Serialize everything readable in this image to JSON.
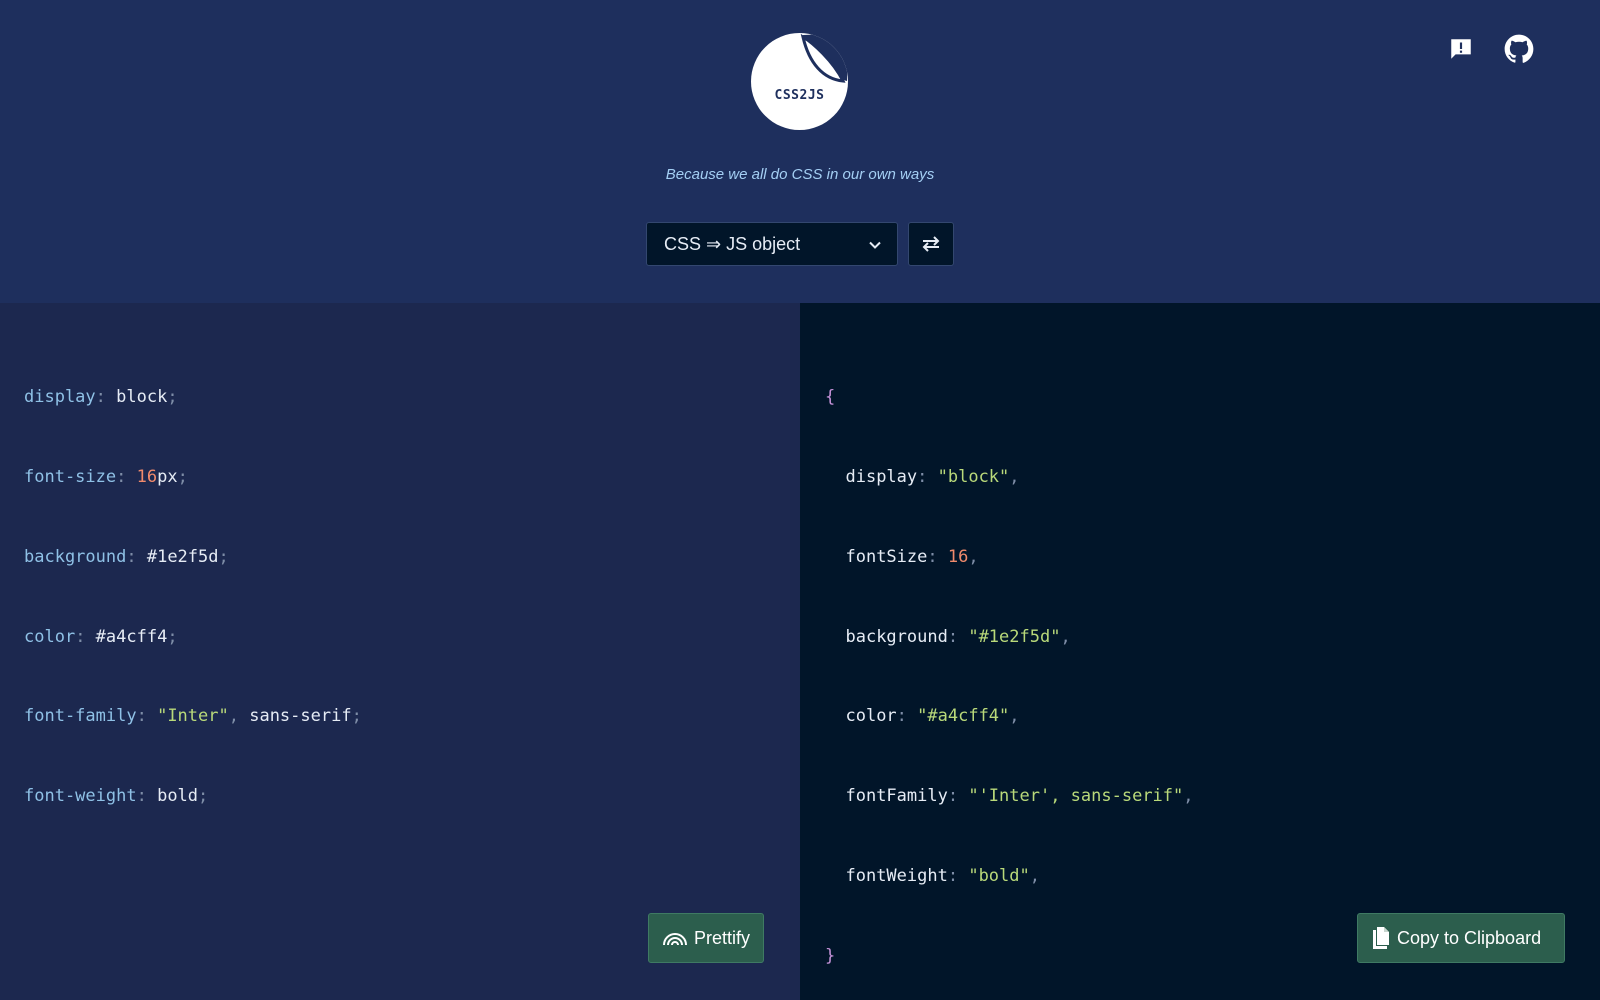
{
  "app": {
    "logo_text": "CSS2JS",
    "tagline": "Because we all do CSS in our own ways"
  },
  "header_icons": {
    "feedback": "feedback-icon",
    "github": "github-icon"
  },
  "controls": {
    "mode_selected": "CSS ⇒ JS object",
    "swap_icon": "swap-arrows-icon"
  },
  "input_code": [
    {
      "prop": "display",
      "value": "block"
    },
    {
      "prop": "font-size",
      "value_num": "16",
      "value_unit": "px"
    },
    {
      "prop": "background",
      "value": "#1e2f5d"
    },
    {
      "prop": "color",
      "value": "#a4cff4"
    },
    {
      "prop": "font-family",
      "value_str": "\"Inter\"",
      "value_rest": "sans-serif"
    },
    {
      "prop": "font-weight",
      "value": "bold"
    }
  ],
  "output_code": {
    "open": "{",
    "close": "}",
    "entries": [
      {
        "key": "display",
        "value": "\"block\"",
        "kind": "str"
      },
      {
        "key": "fontSize",
        "value": "16",
        "kind": "num"
      },
      {
        "key": "background",
        "value": "\"#1e2f5d\"",
        "kind": "str"
      },
      {
        "key": "color",
        "value": "\"#a4cff4\"",
        "kind": "str"
      },
      {
        "key": "fontFamily",
        "value": "\"'Inter', sans-serif\"",
        "kind": "str"
      },
      {
        "key": "fontWeight",
        "value": "\"bold\"",
        "kind": "str"
      }
    ]
  },
  "actions": {
    "prettify_label": "Prettify",
    "copy_label": "Copy to Clipboard"
  },
  "colors": {
    "header_bg": "#1e2f5d",
    "input_bg": "#1c284f",
    "output_bg": "#011529",
    "button_bg": "#2c5e4d",
    "tagline": "#a4cff4"
  }
}
